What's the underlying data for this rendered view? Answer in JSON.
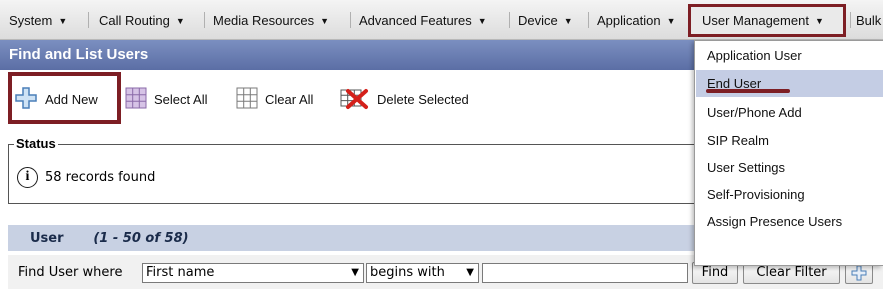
{
  "menu": {
    "items": [
      {
        "label": "System"
      },
      {
        "label": "Call Routing"
      },
      {
        "label": "Media Resources"
      },
      {
        "label": "Advanced Features"
      },
      {
        "label": "Device"
      },
      {
        "label": "Application"
      },
      {
        "label": "User Management"
      },
      {
        "label": "Bulk"
      }
    ],
    "highlight_color": "#7d1e24"
  },
  "page": {
    "title": "Find and List Users"
  },
  "toolbar": {
    "add_new": "Add New",
    "select_all": "Select All",
    "clear_all": "Clear All",
    "delete_selected": "Delete Selected"
  },
  "status": {
    "legend": "Status",
    "message": "58 records found",
    "icon": "info-icon"
  },
  "results": {
    "title": "User",
    "range": "(1 - 50 of 58)"
  },
  "find": {
    "label": "Find User where",
    "field_value": "First name",
    "operator_value": "begins with",
    "search_value": "",
    "find_button": "Find",
    "clear_filter_button": "Clear Filter"
  },
  "dropdown": {
    "items": [
      {
        "label": "Application User"
      },
      {
        "label": "End User"
      },
      {
        "label": "User/Phone Add"
      },
      {
        "label": "SIP Realm"
      },
      {
        "label": "User Settings"
      },
      {
        "label": "Self-Provisioning"
      },
      {
        "label": "Assign Presence Users"
      }
    ],
    "active": "End User"
  },
  "colors": {
    "title_bar": "#5b6ea5",
    "result_header": "#c8d1e3",
    "active_item": "#c4cde4",
    "annotation": "#7d1e24"
  }
}
